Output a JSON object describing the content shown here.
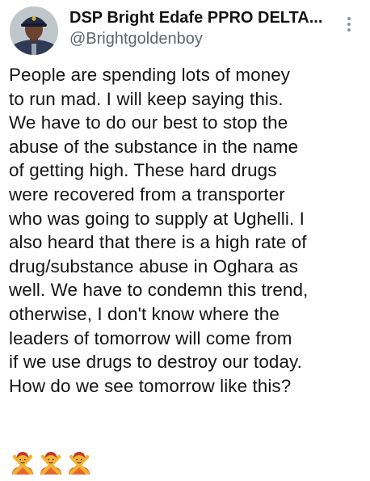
{
  "author": {
    "display_name": "DSP Bright Edafe PPRO DELTA...",
    "handle": "@Brightgoldenboy",
    "avatar_icon": "police-officer-avatar"
  },
  "tweet": {
    "lines": [
      "People are spending lots of money",
      "to run mad. I will keep saying this.",
      "We have to do our best to stop the",
      "abuse of the substance in the name",
      "of getting high. These hard drugs",
      "were recovered from a transporter",
      "who was going to supply at Ughelli. I",
      "also heard that there is a high rate of",
      "drug/substance abuse in Oghara as",
      "well. We have to condemn this trend,",
      "otherwise, I don't know where the",
      "leaders of tomorrow will come from",
      "if we use drugs to destroy our today.",
      "How do we see tomorrow like this?"
    ],
    "emojis": [
      "person-gesturing-no-icon",
      "person-gesturing-no-icon",
      "person-gesturing-no-icon"
    ]
  },
  "menu": {
    "icon": "vertical-ellipsis-icon"
  },
  "colors": {
    "text": "#141414",
    "handle": "#5b6770",
    "emoji_skin": "#f2b233",
    "emoji_shirt": "#e8642c"
  }
}
